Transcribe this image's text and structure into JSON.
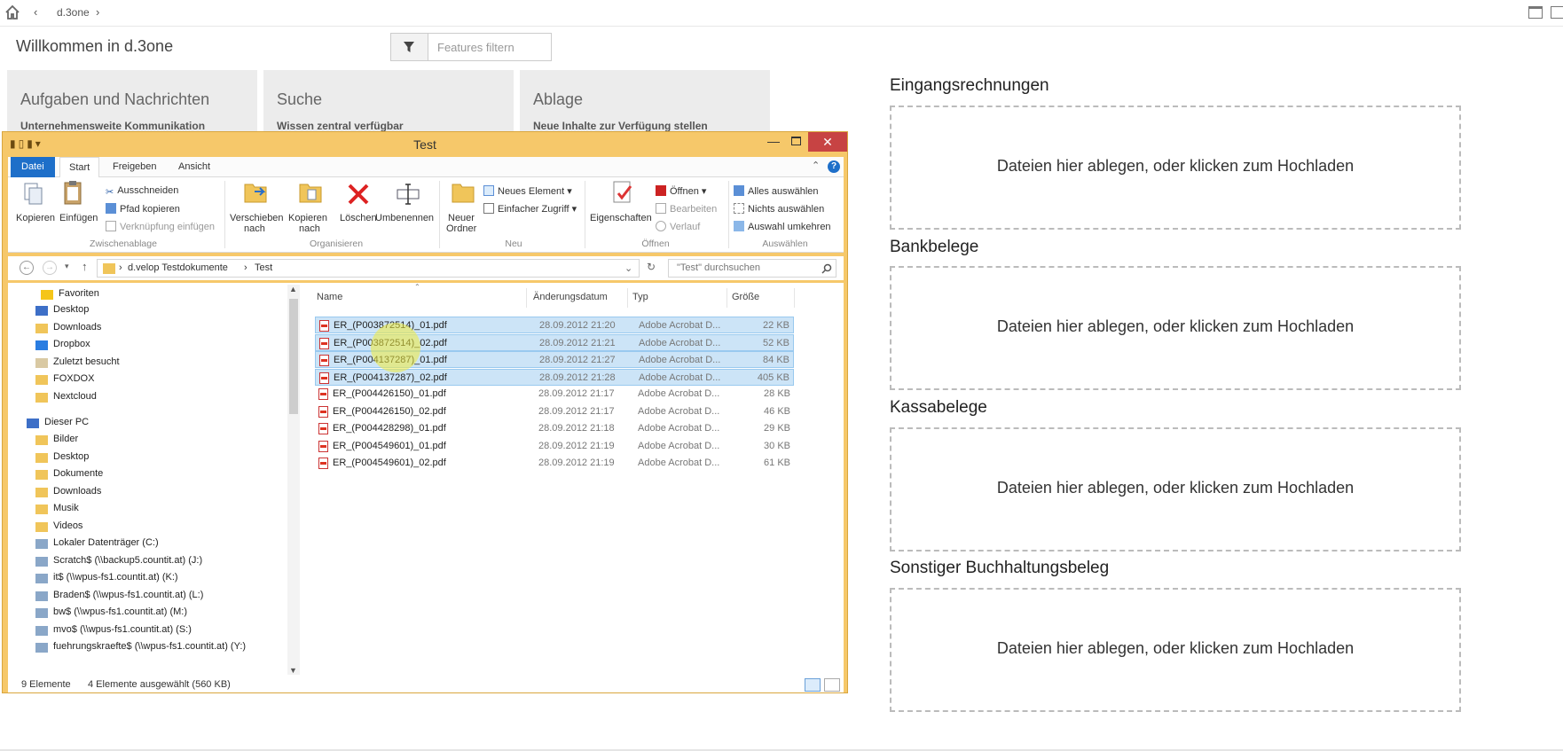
{
  "topbar": {
    "breadcrumb": "d.3one",
    "back": "‹",
    "forward": "›"
  },
  "page": {
    "welcome": "Willkommen in d.3one"
  },
  "filter": {
    "placeholder": "Features filtern"
  },
  "tiles": [
    {
      "title": "Aufgaben und Nachrichten",
      "subtitle": "Unternehmensweite Kommunikation"
    },
    {
      "title": "Suche",
      "subtitle": "Wissen zentral verfügbar"
    },
    {
      "title": "Ablage",
      "subtitle": "Neue Inhalte zur Verfügung stellen"
    }
  ],
  "upload": {
    "hint": "Dateien hier ablegen, oder klicken zum Hochladen",
    "sections": [
      "Eingangsrechnungen",
      "Bankbelege",
      "Kassabelege",
      "Sonstiger Buchhaltungsbeleg"
    ]
  },
  "explorer": {
    "title": "Test",
    "tabs": [
      "Datei",
      "Start",
      "Freigeben",
      "Ansicht"
    ],
    "ribbon": {
      "copy": "Kopieren",
      "paste": "Einfügen",
      "cut": "Ausschneiden",
      "copy_path": "Pfad kopieren",
      "paste_link": "Verknüpfung einfügen",
      "group_clipboard": "Zwischenablage",
      "move_to": "Verschieben",
      "move_to2": "nach",
      "copy_to": "Kopieren",
      "copy_to2": "nach",
      "delete": "Löschen",
      "rename": "Umbenennen",
      "group_organize": "Organisieren",
      "new_folder": "Neuer",
      "new_folder2": "Ordner",
      "new_item": "Neues Element",
      "easy_access": "Einfacher Zugriff",
      "group_new": "Neu",
      "properties": "Eigenschaften",
      "open": "Öffnen",
      "edit": "Bearbeiten",
      "history": "Verlauf",
      "group_open": "Öffnen",
      "select_all": "Alles auswählen",
      "select_none": "Nichts auswählen",
      "invert": "Auswahl umkehren",
      "group_select": "Auswählen"
    },
    "address": {
      "part1": "d.velop Testdokumente",
      "part2": "Test",
      "search_placeholder": "\"Test\" durchsuchen"
    },
    "tree": {
      "favorites": "Favoriten",
      "fav_items": [
        "Desktop",
        "Downloads",
        "Dropbox",
        "Zuletzt besucht",
        "FOXDOX",
        "Nextcloud"
      ],
      "pc": "Dieser PC",
      "pc_items": [
        "Bilder",
        "Desktop",
        "Dokumente",
        "Downloads",
        "Musik",
        "Videos",
        "Lokaler Datenträger (C:)",
        "Scratch$ (\\\\backup5.countit.at) (J:)",
        "it$ (\\\\wpus-fs1.countit.at) (K:)",
        "Braden$ (\\\\wpus-fs1.countit.at) (L:)",
        "bw$ (\\\\wpus-fs1.countit.at) (M:)",
        "mvo$ (\\\\wpus-fs1.countit.at) (S:)",
        "fuehrungskraefte$ (\\\\wpus-fs1.countit.at) (Y:)"
      ]
    },
    "columns": {
      "name": "Name",
      "date": "Änderungsdatum",
      "type": "Typ",
      "size": "Größe"
    },
    "files": [
      {
        "name": "ER_(P003872514)_01.pdf",
        "date": "28.09.2012 21:20",
        "type": "Adobe Acrobat D...",
        "size": "22 KB",
        "selected": true
      },
      {
        "name": "ER_(P003872514)_02.pdf",
        "date": "28.09.2012 21:21",
        "type": "Adobe Acrobat D...",
        "size": "52 KB",
        "selected": true
      },
      {
        "name": "ER_(P004137287)_01.pdf",
        "date": "28.09.2012 21:27",
        "type": "Adobe Acrobat D...",
        "size": "84 KB",
        "selected": true
      },
      {
        "name": "ER_(P004137287)_02.pdf",
        "date": "28.09.2012 21:28",
        "type": "Adobe Acrobat D...",
        "size": "405 KB",
        "selected": true
      },
      {
        "name": "ER_(P004426150)_01.pdf",
        "date": "28.09.2012 21:17",
        "type": "Adobe Acrobat D...",
        "size": "28 KB",
        "selected": false
      },
      {
        "name": "ER_(P004426150)_02.pdf",
        "date": "28.09.2012 21:17",
        "type": "Adobe Acrobat D...",
        "size": "46 KB",
        "selected": false
      },
      {
        "name": "ER_(P004428298)_01.pdf",
        "date": "28.09.2012 21:18",
        "type": "Adobe Acrobat D...",
        "size": "29 KB",
        "selected": false
      },
      {
        "name": "ER_(P004549601)_01.pdf",
        "date": "28.09.2012 21:19",
        "type": "Adobe Acrobat D...",
        "size": "30 KB",
        "selected": false
      },
      {
        "name": "ER_(P004549601)_02.pdf",
        "date": "28.09.2012 21:19",
        "type": "Adobe Acrobat D...",
        "size": "61 KB",
        "selected": false
      }
    ],
    "status": {
      "count": "9 Elemente",
      "selection": "4 Elemente ausgewählt (560 KB)"
    }
  }
}
